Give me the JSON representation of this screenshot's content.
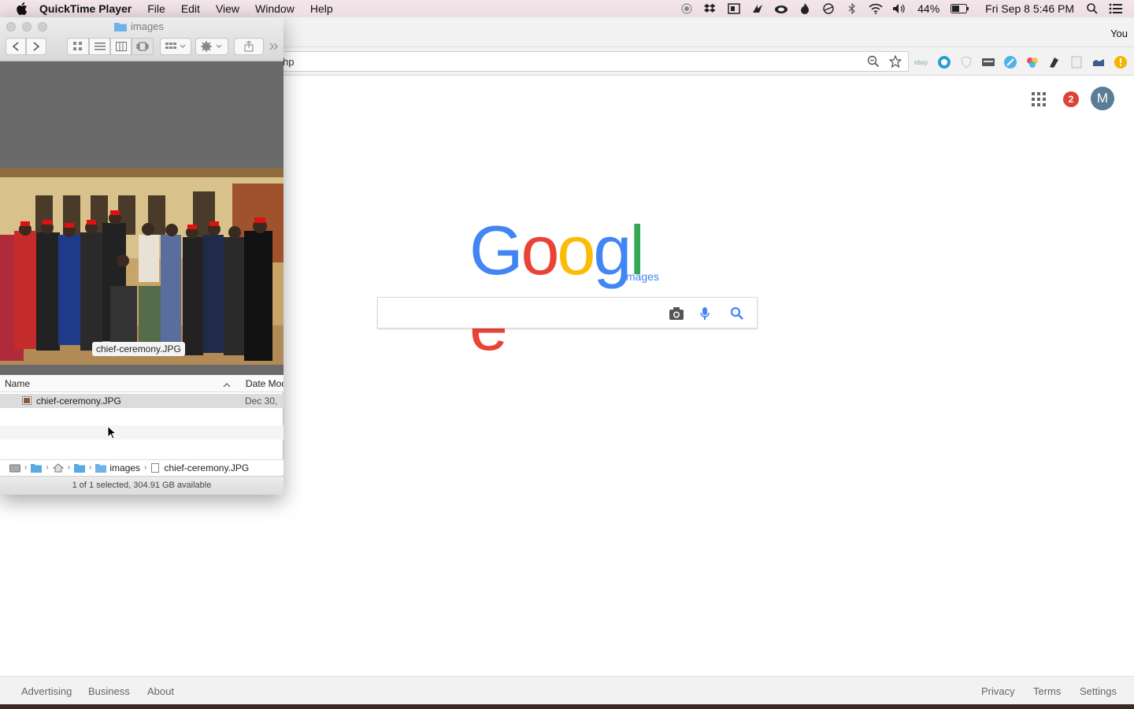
{
  "menubar": {
    "app_name": "QuickTime Player",
    "menus": [
      "File",
      "Edit",
      "View",
      "Window",
      "Help"
    ],
    "battery_percent": "44%",
    "datetime": "Fri Sep 8  5:46 PM"
  },
  "browser": {
    "profile_label": "You",
    "url_fragment": "hp",
    "extensions": [
      "ebay",
      "circle-extension",
      "shield-extension",
      "keyboard-extension",
      "feather-extension",
      "colorwheel-extension",
      "pen-extension",
      "document-extension",
      "cloud-extension",
      "alert-extension"
    ]
  },
  "google": {
    "logo_letters": [
      "G",
      "o",
      "o",
      "g",
      "l",
      "e"
    ],
    "logo_colors": [
      "#4285f4",
      "#ea4335",
      "#fbbc05",
      "#4285f4",
      "#34a853",
      "#ea4335"
    ],
    "logo_sub": "Images",
    "notification_count": "2",
    "avatar_initial": "M",
    "footer_left": [
      "Advertising",
      "Business",
      "About"
    ],
    "footer_right": [
      "Privacy",
      "Terms",
      "Settings"
    ]
  },
  "finder": {
    "title": "images",
    "photo_label": "chief-ceremony.JPG",
    "columns": {
      "name": "Name",
      "date": "Date Mod"
    },
    "files": [
      {
        "name": "chief-ceremony.JPG",
        "date": "Dec 30,"
      }
    ],
    "path": [
      "images",
      "chief-ceremony.JPG"
    ],
    "status": "1 of 1 selected, 304.91 GB available"
  }
}
